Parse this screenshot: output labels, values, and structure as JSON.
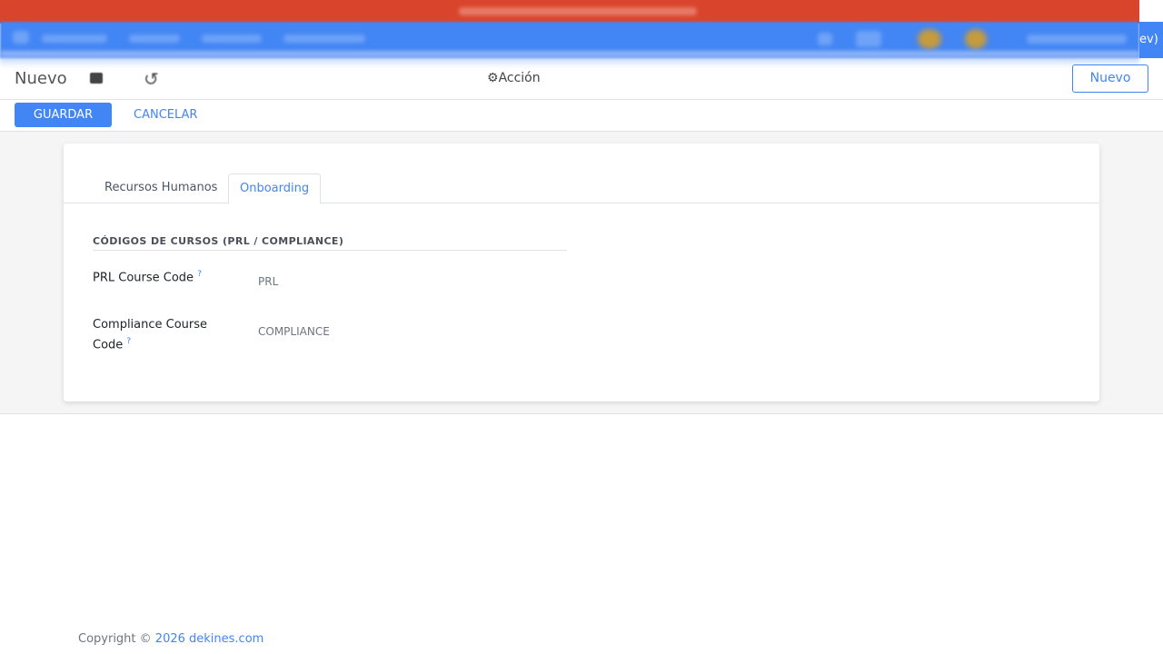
{
  "navbar": {
    "right_fragment": "ev)",
    "brand_color": "#4285f4",
    "banner_color": "#d9452c"
  },
  "control_panel": {
    "title": "Nuevo",
    "action_label": "Acción",
    "new_button": "Nuevo",
    "save_button": "GUARDAR",
    "cancel_button": "CANCELAR"
  },
  "tabs": [
    {
      "label": "Recursos Humanos",
      "active": false
    },
    {
      "label": "Onboarding",
      "active": true
    }
  ],
  "group": {
    "title": "CÓDIGOS DE CURSOS (PRL / COMPLIANCE)",
    "fields": [
      {
        "label_line1": "PRL Course Code",
        "label_line2": "",
        "help": "?",
        "value": "PRL"
      },
      {
        "label_line1": "Compliance Course",
        "label_line2": "Code",
        "help": "?",
        "value": "COMPLIANCE"
      }
    ]
  },
  "footer": {
    "prefix": "Copyright © ",
    "link": "2026 dekines.com"
  }
}
